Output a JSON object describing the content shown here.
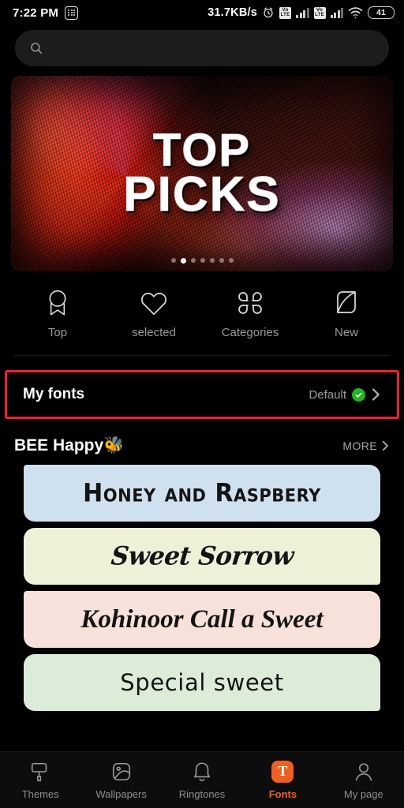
{
  "status_bar": {
    "time": "7:22 PM",
    "left_icon": "calculator-icon",
    "net_speed": "31.7KB/s",
    "alarm_icon": "alarm-clock-icon",
    "sim1_label": "VoLTE",
    "sim2_label": "VoLTE",
    "wifi_icon": "wifi-icon",
    "battery_level": "41"
  },
  "search": {
    "placeholder": "",
    "value": "",
    "icon": "search-icon"
  },
  "banner": {
    "title_line1": "TOP",
    "title_line2": "PICKS",
    "dot_count": 7,
    "active_dot": 1
  },
  "categories": [
    {
      "label": "Top",
      "icon": "medal-ribbon-icon"
    },
    {
      "label": "selected",
      "icon": "heart-icon"
    },
    {
      "label": "Categories",
      "icon": "clover-grid-icon"
    },
    {
      "label": "New",
      "icon": "leaf-icon"
    }
  ],
  "my_fonts": {
    "title": "My fonts",
    "value": "Default",
    "badge_icon": "green-check-icon",
    "chevron_icon": "chevron-right-icon",
    "highlight_color": "#f01f35"
  },
  "section": {
    "title": "BEE Happy🐝",
    "more_label": "MORE",
    "more_icon": "chevron-right-icon"
  },
  "font_cards": [
    {
      "text": "Honey and Raspbery",
      "bg": "#cfe0ee",
      "notch": "top-left"
    },
    {
      "text": "Sweet Sorrow",
      "bg": "#eff0d8",
      "notch": "bottom-right"
    },
    {
      "text": "Kohinoor  Call a Sweet",
      "bg": "#f6e2da",
      "notch": "top-left"
    },
    {
      "text": "Special sweet",
      "bg": "#dcecd9",
      "notch": "bottom-right"
    }
  ],
  "bottom_nav": {
    "active_index": 3,
    "items": [
      {
        "label": "Themes",
        "icon": "paint-roller-icon"
      },
      {
        "label": "Wallpapers",
        "icon": "image-icon"
      },
      {
        "label": "Ringtones",
        "icon": "bell-icon"
      },
      {
        "label": "Fonts",
        "icon": "font-t-icon"
      },
      {
        "label": "My page",
        "icon": "person-icon"
      }
    ],
    "accent_color": "#ef5f24"
  }
}
